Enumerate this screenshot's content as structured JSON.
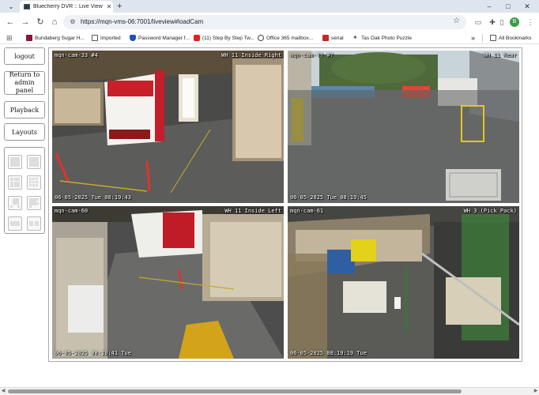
{
  "browser": {
    "tab_title": "Bluecherry DVR :: Live View",
    "url": "https://mqn-vms-06:7001/liveview#loadCam",
    "profile_initial": "B",
    "new_tab_glyph": "+",
    "close_tab_glyph": "✕"
  },
  "bookmarks": {
    "items": [
      {
        "label": "Bundaberg Sugar H...",
        "icon": "bundaberg-icon",
        "color": "#8a1538"
      },
      {
        "label": "Imported",
        "icon": "folder-icon",
        "color": "#555555"
      },
      {
        "label": "Password Manager f...",
        "icon": "shield-icon",
        "color": "#1f4fbf"
      },
      {
        "label": "(11) Step By Step Tw...",
        "icon": "youtube-icon",
        "color": "#e62117"
      },
      {
        "label": "Office 365 mailbox...",
        "icon": "generic-icon",
        "color": "#444444"
      },
      {
        "label": "serial",
        "icon": "pdf-icon",
        "color": "#c62828"
      },
      {
        "label": "Tas Oak Photo Puzzle",
        "icon": "star-icon",
        "color": "#444444"
      }
    ],
    "overflow": "»",
    "all_bookmarks": "All Bookmarks"
  },
  "sidebar": {
    "logout": "logout",
    "return_admin": "Return to admin panel",
    "playback": "Playback",
    "layouts": "Layouts"
  },
  "cameras": [
    {
      "name": "mqn-cam-33 #4",
      "location": "WH 11 Inside Right",
      "timestamp": "06-05-2025 Tue 08:19:43"
    },
    {
      "name": "mqn-cam-?? #?",
      "location": "WH 11 Rear",
      "timestamp": "06-05-2025 Tue 08:19:45"
    },
    {
      "name": "mqn-cam-60",
      "location": "WH 11 Inside Left",
      "timestamp": "06-05-2025 08:19:41 Tue"
    },
    {
      "name": "mqn-cam-61",
      "location": "WH 3 (Pick Pack)",
      "timestamp": "06-05-2025 08:19:19 Tue"
    }
  ],
  "colors": {
    "accent": "#3c9a48",
    "tab_strip": "#dfe5ee"
  }
}
